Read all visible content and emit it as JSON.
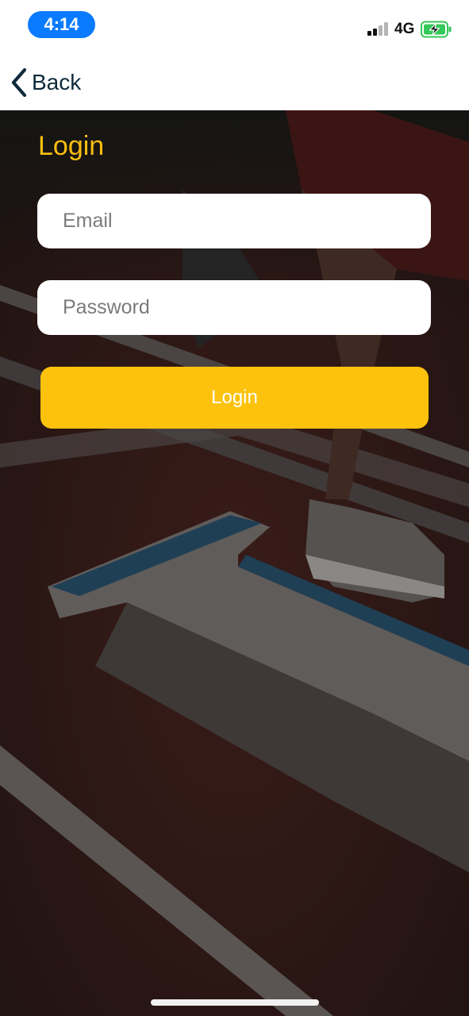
{
  "status_bar": {
    "time": "4:14",
    "network": "4G",
    "icons": [
      "signal-icon",
      "battery-charging-icon"
    ],
    "time_pill_color": "#0a7aff",
    "battery_color": "#34c759"
  },
  "nav": {
    "back_label": "Back",
    "back_icon": "chevron-left-icon"
  },
  "login": {
    "title": "Login",
    "email_placeholder": "Email",
    "password_placeholder": "Password",
    "button_label": "Login",
    "accent_color": "#fdc20d"
  }
}
